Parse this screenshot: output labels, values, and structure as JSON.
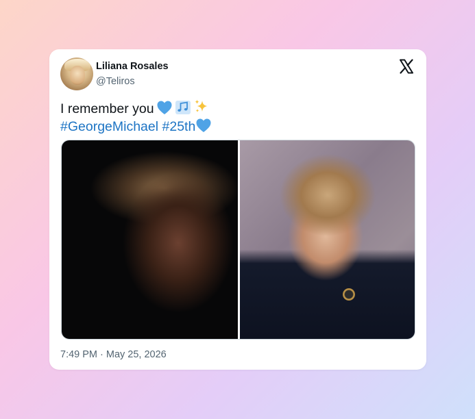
{
  "tweet": {
    "author_name": "Liliana Rosales",
    "handle": "@Teliros",
    "text_line1": "I remember you",
    "hashtag1": "#GeorgeMichael",
    "hashtag2": "#25th",
    "timestamp": "7:49 PM · May 25, 2026",
    "emojis_line1": [
      "blue-heart-icon",
      "musical-notes-icon",
      "sparkles-icon"
    ],
    "emojis_line2": [
      "blue-heart-icon"
    ]
  },
  "colors": {
    "hashtag": "#1d74c4",
    "blue_heart": "#4fa3e6",
    "sparkles": "#f7c33b",
    "secondary_text": "#536471"
  },
  "media": {
    "images": [
      "man-portrait-dark-photo",
      "man-portrait-studio-photo"
    ]
  }
}
